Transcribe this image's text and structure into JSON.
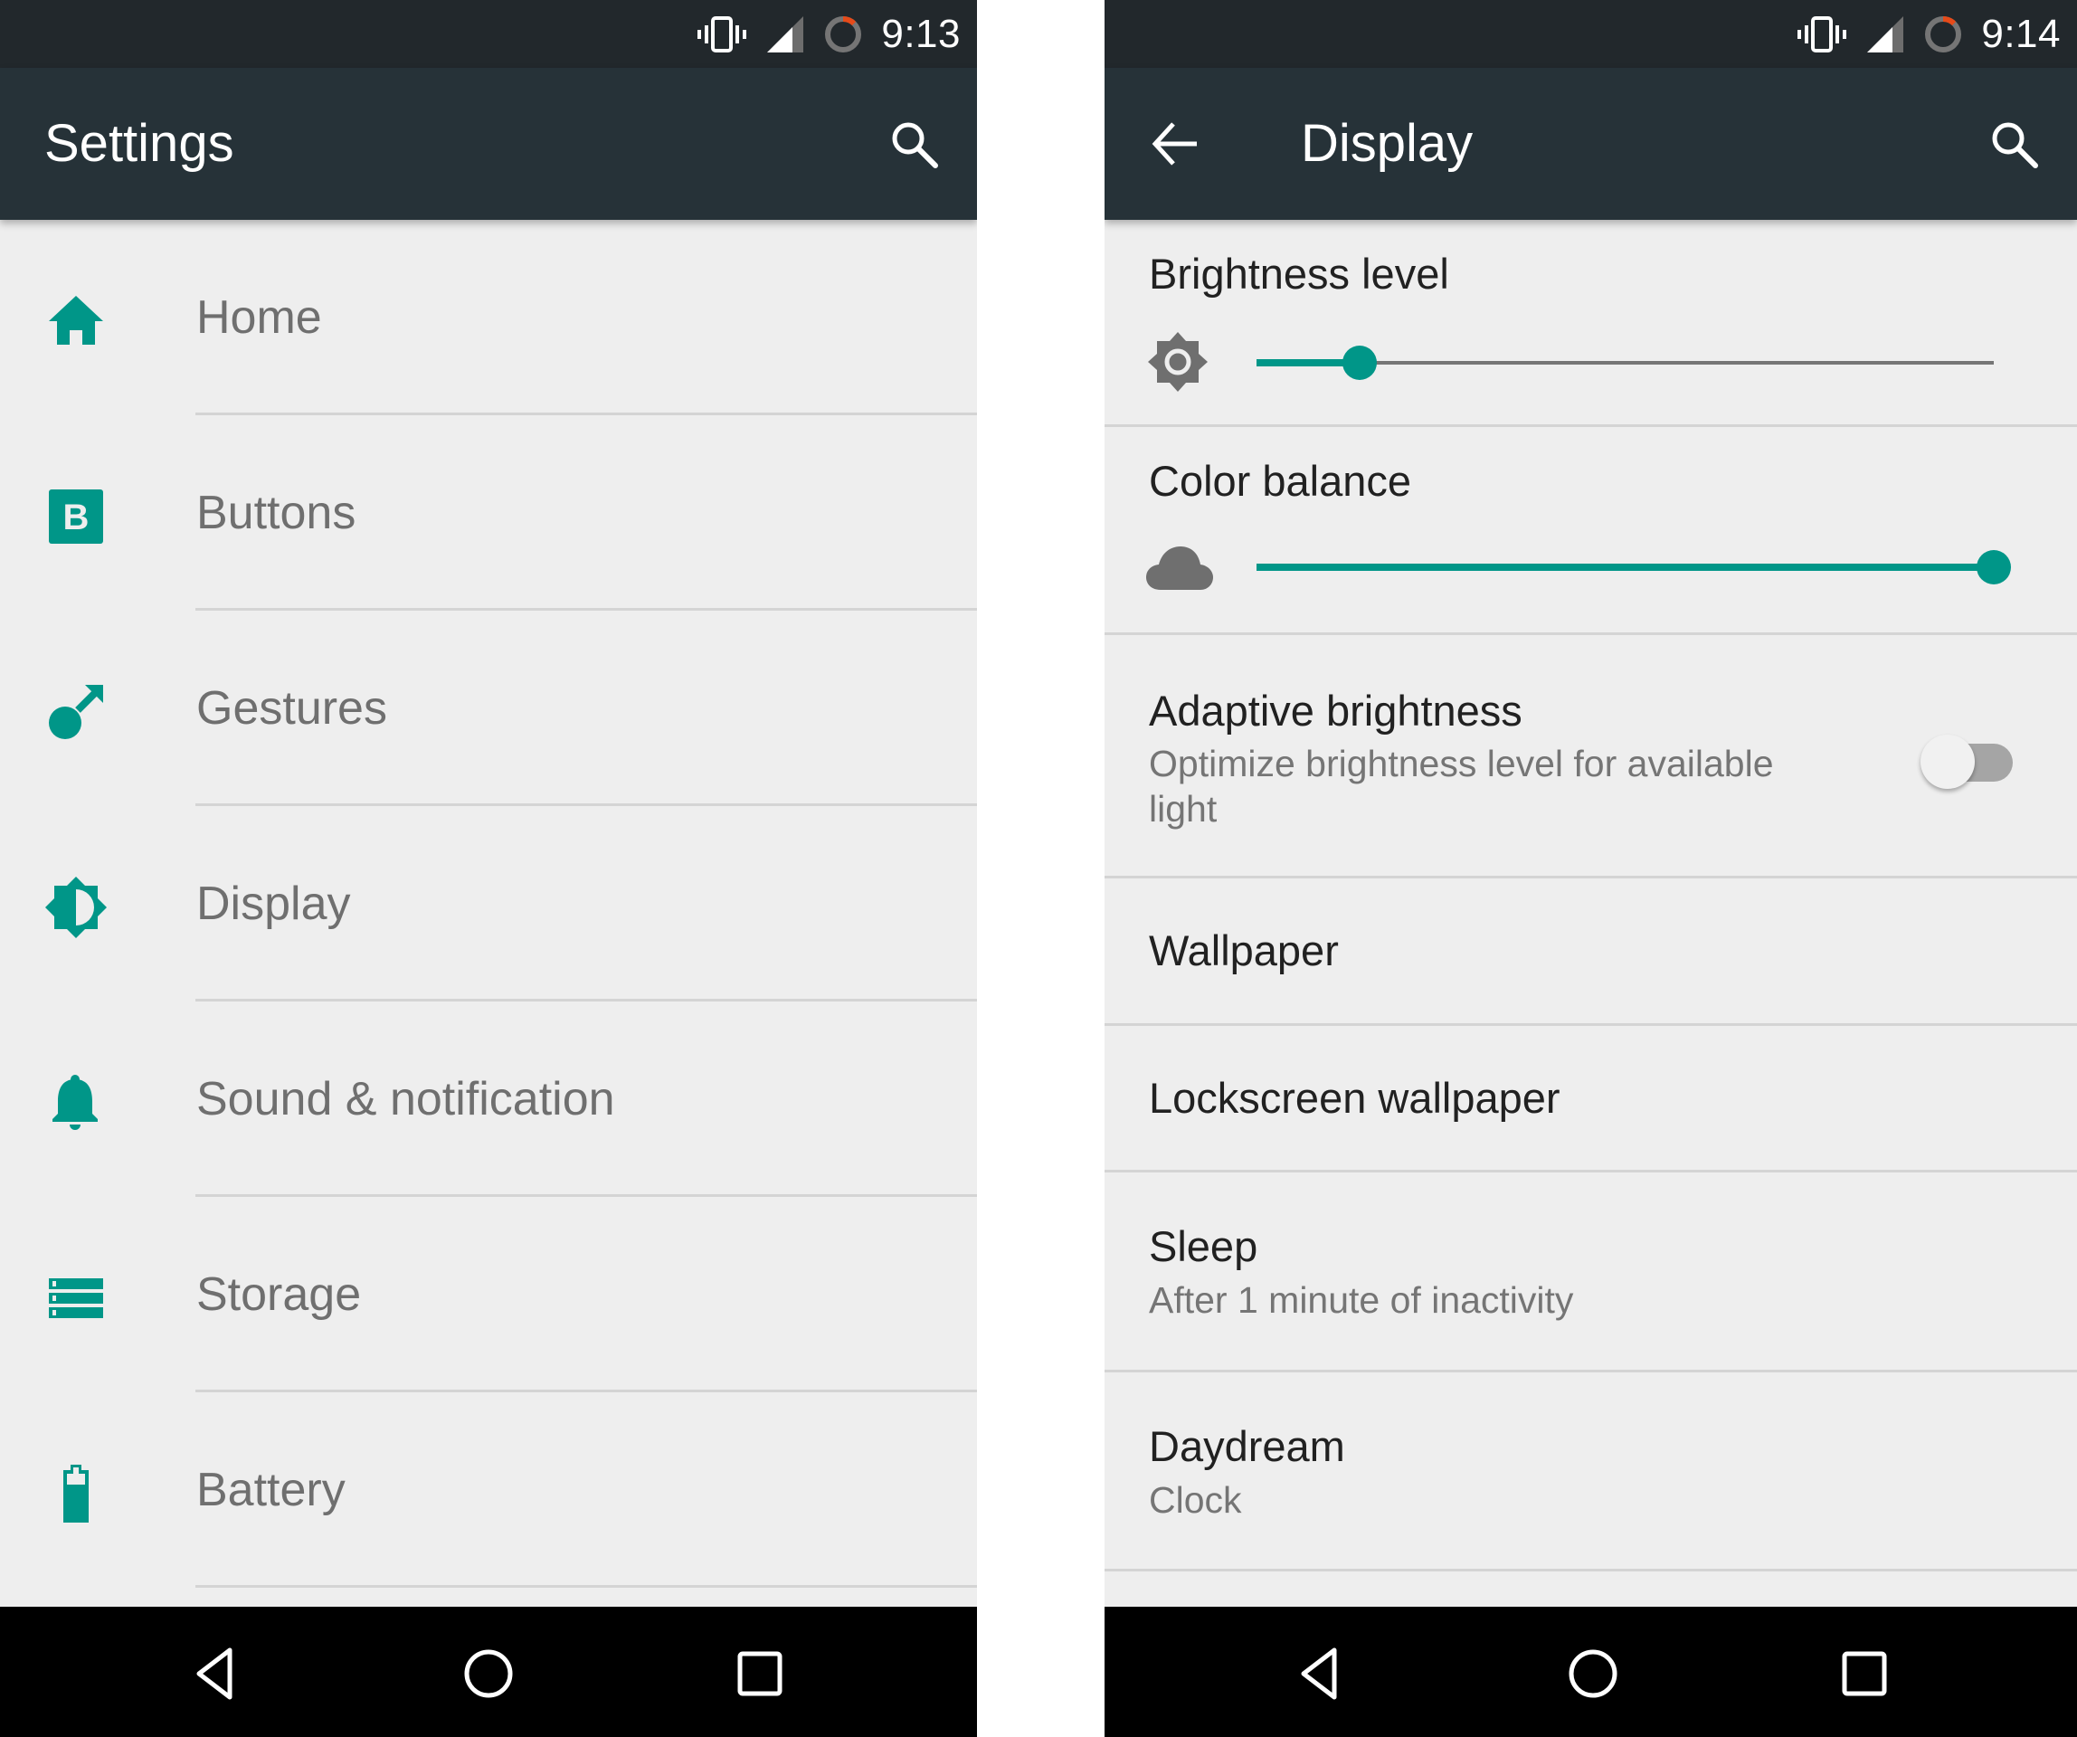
{
  "colors": {
    "accent": "#009688",
    "appbar": "#263238",
    "statusbar": "#22282c",
    "background": "#eeeeee",
    "battery_low": "#e64a19"
  },
  "left": {
    "status": {
      "time": "9:13",
      "icons": [
        "vibrate-icon",
        "signal-icon",
        "battery-ring-icon"
      ]
    },
    "appbar": {
      "title": "Settings",
      "action_icon": "search-icon"
    },
    "items": [
      {
        "label": "Home",
        "icon": "home-icon"
      },
      {
        "label": "Buttons",
        "icon": "buttons-icon"
      },
      {
        "label": "Gestures",
        "icon": "gestures-icon"
      },
      {
        "label": "Display",
        "icon": "display-brightness-icon"
      },
      {
        "label": "Sound & notification",
        "icon": "bell-icon"
      },
      {
        "label": "Storage",
        "icon": "storage-icon"
      },
      {
        "label": "Battery",
        "icon": "battery-icon"
      }
    ],
    "navbar": [
      "back-icon",
      "home-circle-icon",
      "recents-icon"
    ]
  },
  "right": {
    "status": {
      "time": "9:14",
      "icons": [
        "vibrate-icon",
        "signal-icon",
        "battery-ring-icon"
      ]
    },
    "appbar": {
      "title": "Display",
      "nav_icon": "back-arrow-icon",
      "action_icon": "search-icon"
    },
    "brightness": {
      "title": "Brightness level",
      "icon": "brightness-icon",
      "value": 0.14
    },
    "color_balance": {
      "title": "Color balance",
      "icon": "cloud-icon",
      "value": 1.0
    },
    "adaptive": {
      "title": "Adaptive brightness",
      "summary_line1": "Optimize brightness level for available",
      "summary_line2": "light",
      "enabled": false
    },
    "wallpaper": {
      "title": "Wallpaper"
    },
    "lockscreen": {
      "title": "Lockscreen wallpaper"
    },
    "sleep": {
      "title": "Sleep",
      "summary": "After 1 minute of inactivity"
    },
    "daydream": {
      "title": "Daydream",
      "summary": "Clock"
    },
    "navbar": [
      "back-icon",
      "home-circle-icon",
      "recents-icon"
    ]
  }
}
